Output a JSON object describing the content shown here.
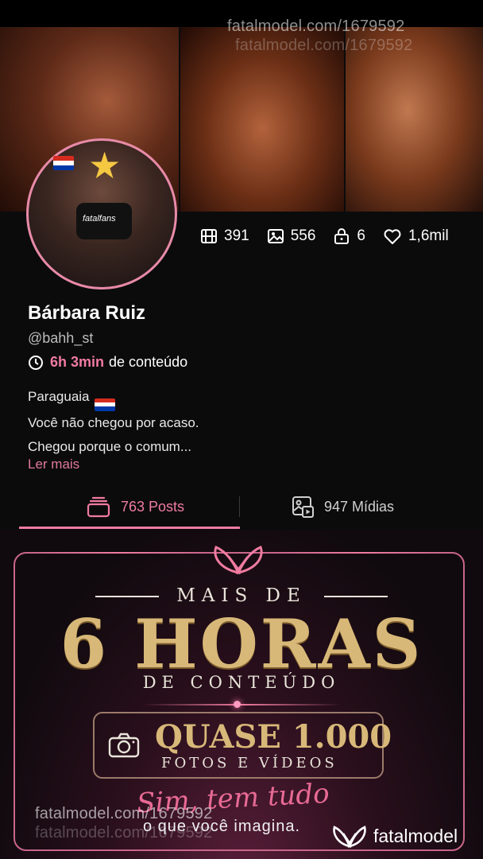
{
  "watermark": {
    "top": "fatalmodel.com/1679592",
    "top_faint": "fatalmodel.com/1679592",
    "bottom": "fatalmodel.com/1679592",
    "bottom_faint": "fatalmodel.com/1679592"
  },
  "avatar": {
    "shirt_text": "fatalfans"
  },
  "stats": {
    "videos": "391",
    "photos": "556",
    "locked": "6",
    "likes": "1,6mil"
  },
  "profile": {
    "name": "Bárbara Ruiz",
    "handle": "@bahh_st",
    "duration_value": "6h 3min",
    "duration_suffix": "de conteúdo",
    "bio_line1": "Paraguaia",
    "bio_line2": "Você não chegou por acaso.",
    "bio_line3": "Chegou porque o comum...",
    "read_more": "Ler mais"
  },
  "tabs": {
    "posts": "763 Posts",
    "media": "947 Mídias"
  },
  "promo": {
    "line1": "MAIS DE",
    "line2": "6 HORAS",
    "line3": "DE CONTEÚDO",
    "box_title": "QUASE 1.000",
    "box_sub": "FOTOS E VÍDEOS",
    "script": "Sim, tem tudo",
    "tagline": "o que você imagina.",
    "brand": "fatalmodel"
  },
  "colors": {
    "accent": "#f07ba0",
    "gold": "#d8b878",
    "background": "#0b0b0c"
  },
  "icons": [
    "film-icon",
    "image-icon",
    "lock-icon",
    "heart-icon",
    "clock-icon",
    "posts-stack-icon",
    "media-icon",
    "camera-icon",
    "butterfly-icon"
  ]
}
